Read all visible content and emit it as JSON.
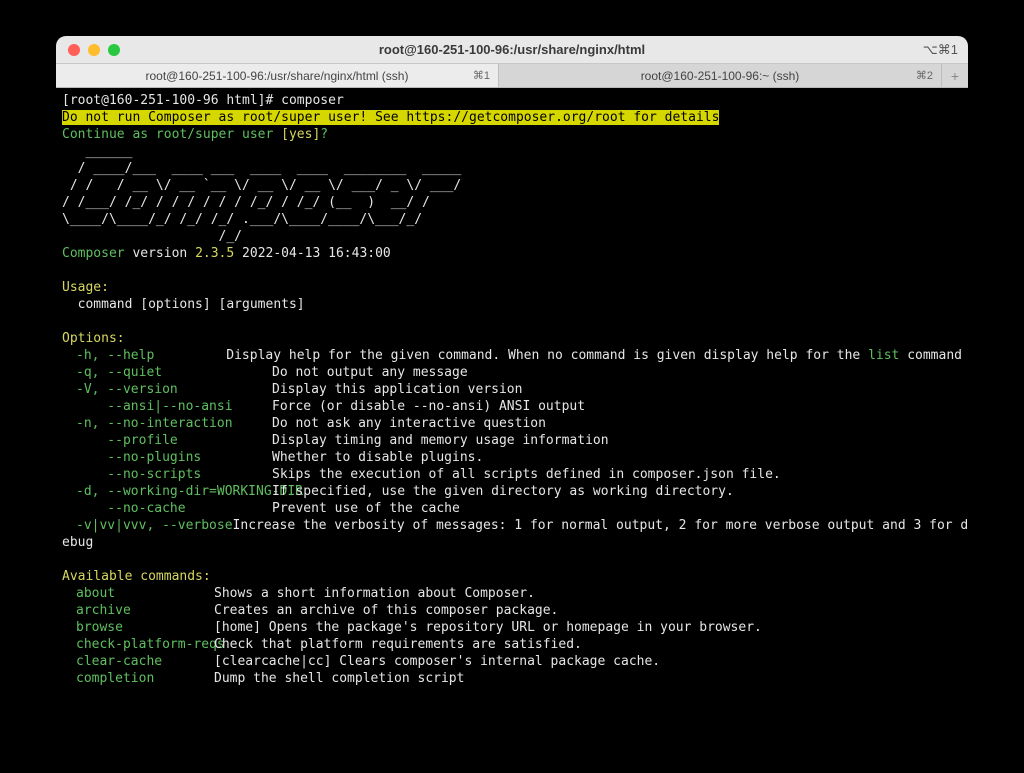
{
  "window": {
    "title": "root@160-251-100-96:/usr/share/nginx/html",
    "shortcut": "⌥⌘1"
  },
  "tabs": [
    {
      "label": "root@160-251-100-96:/usr/share/nginx/html (ssh)",
      "shortcut": "⌘1",
      "active": true
    },
    {
      "label": "root@160-251-100-96:~ (ssh)",
      "shortcut": "⌘2",
      "active": false
    }
  ],
  "prompt": {
    "text": "[root@160-251-100-96 html]# ",
    "command": "composer"
  },
  "warning": "Do not run Composer as root/super user! See https://getcomposer.org/root for details",
  "continue_line": {
    "text": "Continue as root/super user ",
    "hint": "[yes]",
    "suffix": "?"
  },
  "ascii": "   ______\n  / ____/___  ____ ___  ____  ____  ________  _____\n / /   / __ \\/ __ `__ \\/ __ \\/ __ \\/ ___/ _ \\/ ___/\n/ /___/ /_/ / / / / / / /_/ / /_/ (__  )  __/ /\n\\____/\\____/_/ /_/ /_/ .___/\\____/____/\\___/_/\n                    /_/",
  "version": {
    "label": "Composer",
    "middle": " version ",
    "num": "2.3.5",
    "date": " 2022-04-13 16:43:00"
  },
  "usage_header": "Usage:",
  "usage_line": "  command [options] [arguments]",
  "options_header": "Options:",
  "options": [
    {
      "flag": "-h, --help",
      "desc_pre": "Display help for the given command. When no command is given display help for the ",
      "desc_cmd": "list",
      "desc_post": " command"
    },
    {
      "flag": "-q, --quiet",
      "desc": "Do not output any message"
    },
    {
      "flag": "-V, --version",
      "desc": "Display this application version"
    },
    {
      "flag": "    --ansi|--no-ansi",
      "desc": "Force (or disable --no-ansi) ANSI output"
    },
    {
      "flag": "-n, --no-interaction",
      "desc": "Do not ask any interactive question"
    },
    {
      "flag": "    --profile",
      "desc": "Display timing and memory usage information"
    },
    {
      "flag": "    --no-plugins",
      "desc": "Whether to disable plugins."
    },
    {
      "flag": "    --no-scripts",
      "desc": "Skips the execution of all scripts defined in composer.json file."
    },
    {
      "flag": "-d, --working-dir=WORKING-DIR",
      "desc": "If specified, use the given directory as working directory."
    },
    {
      "flag": "    --no-cache",
      "desc": "Prevent use of the cache"
    },
    {
      "flag": "-v|vv|vvv, --verbose",
      "desc": "Increase the verbosity of messages: 1 for normal output, 2 for more verbose output and 3 for d"
    }
  ],
  "options_wrap": "ebug",
  "commands_header": "Available commands:",
  "commands": [
    {
      "name": "about",
      "desc": "Shows a short information about Composer."
    },
    {
      "name": "archive",
      "desc": "Creates an archive of this composer package."
    },
    {
      "name": "browse",
      "desc": "[home] Opens the package's repository URL or homepage in your browser."
    },
    {
      "name": "check-platform-reqs",
      "desc": "Check that platform requirements are satisfied."
    },
    {
      "name": "clear-cache",
      "desc": "[clearcache|cc] Clears composer's internal package cache."
    },
    {
      "name": "completion",
      "desc": "Dump the shell completion script"
    }
  ],
  "add_tab": "+"
}
